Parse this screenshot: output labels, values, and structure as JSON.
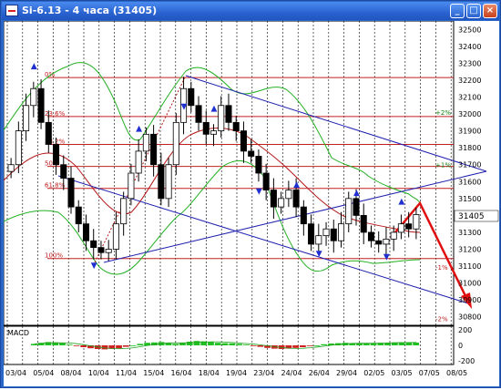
{
  "window": {
    "title": "Si-6.13 - 4 часа (31405)",
    "minimize_glyph": "_",
    "maximize_glyph": "□",
    "close_glyph": "×"
  },
  "chart_data": {
    "type": "candlestick",
    "y_ticks": [
      "32500",
      "32400",
      "32300",
      "32200",
      "32100",
      "32000",
      "31900",
      "31800",
      "31700",
      "31600",
      "31500",
      "31400",
      "31300",
      "31200",
      "31100",
      "31000",
      "30900",
      "30800"
    ],
    "current_price_label": "31405",
    "x_ticks": [
      "03/04",
      "05/04",
      "08/04",
      "10/04",
      "11/04",
      "15/04",
      "16/04",
      "18/04",
      "19/04",
      "23/04",
      "24/04",
      "26/04",
      "29/04",
      "02/05",
      "03/05",
      "07/05",
      "08/05"
    ],
    "fib_levels": [
      {
        "label": "0%",
        "price": 32215
      },
      {
        "label": "23.6%",
        "price": 31985
      },
      {
        "label": "38.2%",
        "price": 31820
      },
      {
        "label": "50%",
        "price": 31690
      },
      {
        "label": "61.8%",
        "price": 31560
      },
      {
        "label": "100%",
        "price": 31145
      }
    ],
    "right_levels": [
      {
        "label": "+2%",
        "price": 32010
      },
      {
        "label": "+1%",
        "price": 31700
      },
      {
        "label": "-1%",
        "price": 31095
      },
      {
        "label": "-2%",
        "price": 30790
      }
    ],
    "macd_label": "MACD",
    "macd_ticks": [
      "200",
      "0",
      "-200"
    ],
    "prices_close": [
      31700,
      31900,
      32050,
      32150,
      31950,
      31820,
      31700,
      31620,
      31450,
      31350,
      31250,
      31210,
      31180,
      31200,
      31350,
      31500,
      31650,
      31780,
      31880,
      31700,
      31500,
      31700,
      31950,
      32150,
      32050,
      31950,
      31880,
      31900,
      32050,
      31950,
      31900,
      31780,
      31750,
      31650,
      31550,
      31450,
      31500,
      31550,
      31450,
      31350,
      31230,
      31280,
      31320,
      31250,
      31350,
      31500,
      31400,
      31300,
      31250,
      31230,
      31260,
      31300,
      31350,
      31320,
      31405
    ],
    "macd_values": [
      20,
      35,
      45,
      40,
      30,
      10,
      -10,
      -25,
      -40,
      -50,
      -55,
      -48,
      -40,
      -20,
      0,
      20,
      35,
      40,
      45,
      30,
      20,
      35,
      50,
      60,
      55,
      45,
      35,
      30,
      28,
      20,
      10,
      -5,
      -20,
      -35,
      -45,
      -50,
      -45,
      -35,
      -25,
      -10,
      0,
      15,
      25,
      30,
      35,
      30,
      25,
      28,
      32,
      35,
      38,
      40,
      42,
      40,
      38
    ]
  }
}
